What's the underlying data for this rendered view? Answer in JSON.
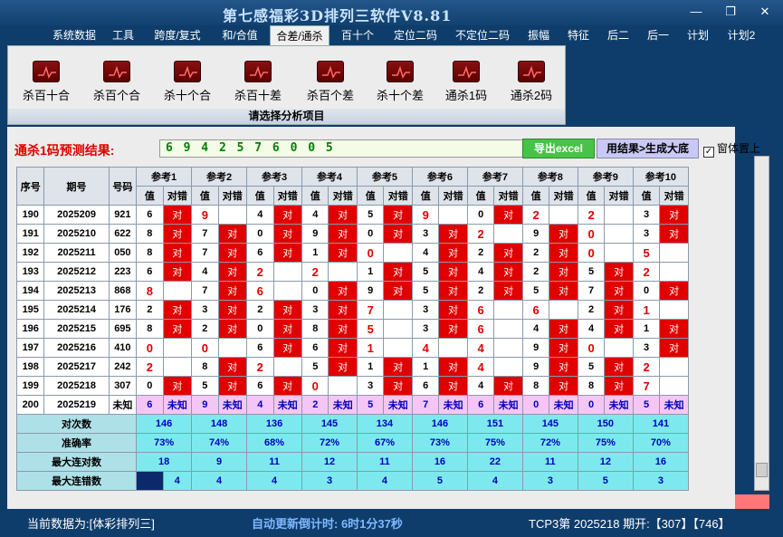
{
  "app": {
    "title": "第七感福彩3D排列三软件V8.81",
    "minimize": "—",
    "restore": "❐",
    "close": "✕"
  },
  "menu": [
    "系统数据",
    "工具",
    "跨度/复式",
    "和/合值",
    "合差/通杀",
    "百十个",
    "定位二码",
    "不定位二码",
    "振幅",
    "特征",
    "后二",
    "后一",
    "计划",
    "计划2"
  ],
  "active_menu": "合差/通杀",
  "ribbon": {
    "buttons": [
      "杀百十合",
      "杀百个合",
      "杀十个合",
      "杀百十差",
      "杀百个差",
      "杀十个差",
      "通杀1码",
      "通杀2码"
    ],
    "caption": "请选择分析项目",
    "icon": "chart-line-icon"
  },
  "prediction": {
    "label": "通杀1码预测结果:",
    "value": "6 9 4 2 5 7 6 0 0 5"
  },
  "buttons": {
    "excel": "导出excel",
    "generate": "用结果>生成大底"
  },
  "topmost": {
    "label": "窗体置上",
    "checked": true,
    "check_glyph": "✓"
  },
  "table": {
    "headers": {
      "seq": "序号",
      "period": "期号",
      "number": "号码",
      "refs": [
        "参考1",
        "参考2",
        "参考3",
        "参考4",
        "参考5",
        "参考6",
        "参考7",
        "参考8",
        "参考9",
        "参考10"
      ],
      "val": "值",
      "hit": "对错"
    },
    "rows": [
      {
        "seq": "190",
        "period": "2025209",
        "number": "921",
        "vals": [
          "6",
          "9",
          "4",
          "4",
          "5",
          "9",
          "0",
          "2",
          "2",
          "3"
        ],
        "hits": [
          "对",
          "",
          "对",
          "对",
          "对",
          "",
          "对",
          "",
          "",
          "对"
        ]
      },
      {
        "seq": "191",
        "period": "2025210",
        "number": "622",
        "vals": [
          "8",
          "7",
          "0",
          "9",
          "0",
          "3",
          "2",
          "9",
          "0",
          "3"
        ],
        "hits": [
          "对",
          "对",
          "对",
          "对",
          "对",
          "对",
          "",
          "对",
          "",
          "对"
        ]
      },
      {
        "seq": "192",
        "period": "2025211",
        "number": "050",
        "vals": [
          "8",
          "7",
          "6",
          "1",
          "0",
          "4",
          "2",
          "2",
          "0",
          "5"
        ],
        "hits": [
          "对",
          "对",
          "对",
          "对",
          "",
          "对",
          "对",
          "对",
          "",
          ""
        ]
      },
      {
        "seq": "193",
        "period": "2025212",
        "number": "223",
        "vals": [
          "6",
          "4",
          "2",
          "2",
          "1",
          "5",
          "4",
          "2",
          "5",
          "2"
        ],
        "hits": [
          "对",
          "对",
          "",
          "",
          "对",
          "对",
          "对",
          "对",
          "对",
          ""
        ]
      },
      {
        "seq": "194",
        "period": "2025213",
        "number": "868",
        "vals": [
          "8",
          "7",
          "6",
          "0",
          "9",
          "5",
          "2",
          "5",
          "7",
          "0"
        ],
        "hits": [
          "",
          "对",
          "",
          "对",
          "对",
          "对",
          "对",
          "对",
          "对",
          "对"
        ]
      },
      {
        "seq": "195",
        "period": "2025214",
        "number": "176",
        "vals": [
          "2",
          "3",
          "2",
          "3",
          "7",
          "3",
          "6",
          "6",
          "2",
          "1"
        ],
        "hits": [
          "对",
          "对",
          "对",
          "对",
          "",
          "对",
          "",
          "",
          "对",
          ""
        ]
      },
      {
        "seq": "196",
        "period": "2025215",
        "number": "695",
        "vals": [
          "8",
          "2",
          "0",
          "8",
          "5",
          "3",
          "6",
          "4",
          "4",
          "1"
        ],
        "hits": [
          "对",
          "对",
          "对",
          "对",
          "",
          "对",
          "",
          "对",
          "对",
          "对"
        ]
      },
      {
        "seq": "197",
        "period": "2025216",
        "number": "410",
        "vals": [
          "0",
          "0",
          "6",
          "6",
          "1",
          "4",
          "4",
          "9",
          "0",
          "3"
        ],
        "hits": [
          "",
          "",
          "对",
          "对",
          "",
          "",
          "",
          "对",
          "",
          "对"
        ]
      },
      {
        "seq": "198",
        "period": "2025217",
        "number": "242",
        "vals": [
          "2",
          "8",
          "2",
          "5",
          "1",
          "1",
          "4",
          "9",
          "5",
          "2"
        ],
        "hits": [
          "",
          "对",
          "",
          "对",
          "对",
          "对",
          "",
          "对",
          "对",
          ""
        ]
      },
      {
        "seq": "199",
        "period": "2025218",
        "number": "307",
        "vals": [
          "0",
          "5",
          "6",
          "0",
          "3",
          "6",
          "4",
          "8",
          "8",
          "7"
        ],
        "hits": [
          "对",
          "对",
          "对",
          "",
          "对",
          "对",
          "对",
          "对",
          "对",
          ""
        ]
      }
    ],
    "prediction_row": {
      "seq": "200",
      "period": "2025219",
      "number": "未知",
      "vals": [
        "6",
        "9",
        "4",
        "2",
        "5",
        "7",
        "6",
        "0",
        "0",
        "5"
      ],
      "hits": [
        "未知",
        "未知",
        "未知",
        "未知",
        "未知",
        "未知",
        "未知",
        "未知",
        "未知",
        "未知"
      ]
    },
    "stats": [
      {
        "label": "对次数",
        "values": [
          "146",
          "148",
          "136",
          "145",
          "134",
          "146",
          "151",
          "145",
          "150",
          "141"
        ]
      },
      {
        "label": "准确率",
        "values": [
          "73%",
          "74%",
          "68%",
          "72%",
          "67%",
          "73%",
          "75%",
          "72%",
          "75%",
          "70%"
        ]
      },
      {
        "label": "最大连对数",
        "values": [
          "18",
          "9",
          "11",
          "12",
          "11",
          "16",
          "22",
          "11",
          "12",
          "16"
        ]
      },
      {
        "label": "最大连错数",
        "values": [
          "4",
          "4",
          "4",
          "3",
          "4",
          "5",
          "4",
          "3",
          "5",
          "3"
        ]
      }
    ]
  },
  "status": {
    "data_label": "当前数据为:[体彩排列三]",
    "countdown": "自动更新倒计时:  6时1分37秒",
    "lottery": "TCP3第  2025218  期开:【307】【746】"
  }
}
